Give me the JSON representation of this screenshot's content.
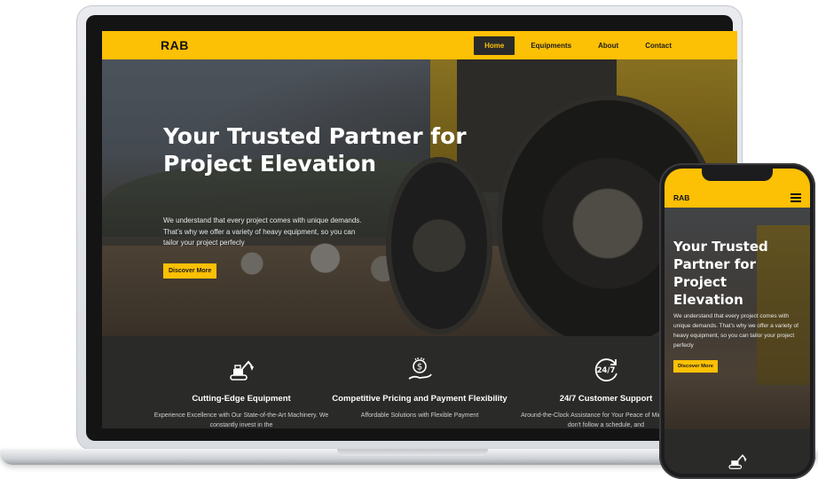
{
  "site": {
    "logo": "RAB",
    "nav": {
      "items": [
        {
          "label": "Home",
          "active": true
        },
        {
          "label": "Equipments",
          "active": false
        },
        {
          "label": "About",
          "active": false
        },
        {
          "label": "Contact",
          "active": false
        }
      ]
    },
    "hero": {
      "title": "Your Trusted Partner for Project Elevation",
      "description": "We understand that every project comes with unique demands. That’s why we offer a variety of heavy equipment, so you can tailor your project perfecly",
      "cta_label": "Discover More"
    },
    "features": [
      {
        "icon": "excavator-icon",
        "title": "Cutting-Edge Equipment",
        "text": "Experience Excellence with Our State-of-the-Art Machinery. We constantly invest in the"
      },
      {
        "icon": "dollar-hand-icon",
        "title": "Competitive Pricing and Payment Flexibility",
        "text": "Affordable Solutions with Flexible Payment"
      },
      {
        "icon": "support-24-7-icon",
        "title": "24/7 Customer Support",
        "text": "Around-the-Clock Assistance for Your Peace of Mind. Projects don't follow a schedule, and"
      }
    ]
  },
  "mobile": {
    "logo": "RAB",
    "menu_icon": "hamburger-icon",
    "hero": {
      "title": "Your Trusted Partner for Project Elevation",
      "description": "We understand that every project comes with unique demands. That’s why we offer a variety of heavy equipment, so you can tailor your project perfecly",
      "cta_label": "Discover More"
    }
  },
  "colors": {
    "brand_yellow": "#fcc004",
    "dark": "#2a2b29",
    "nav_active_bg": "#2a2a2a"
  }
}
